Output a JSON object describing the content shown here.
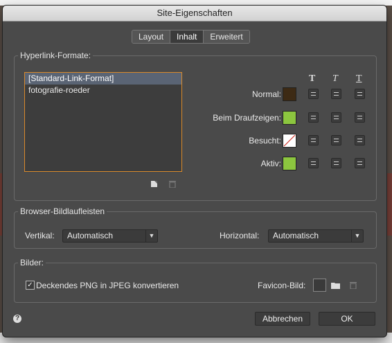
{
  "window": {
    "title": "Site-Eigenschaften"
  },
  "tabs": [
    {
      "label": "Layout",
      "active": false
    },
    {
      "label": "Inhalt",
      "active": true
    },
    {
      "label": "Erweitert",
      "active": false
    }
  ],
  "hyperlinks": {
    "group_title": "Hyperlink-Formate:",
    "list": [
      {
        "label": "[Standard-Link-Format]",
        "selected": true
      },
      {
        "label": "fotografie-roeder",
        "selected": false
      }
    ],
    "format_icons": [
      "bold-t-icon",
      "italic-t-icon",
      "underline-t-icon"
    ],
    "new_icon": "new-item-icon",
    "delete_icon": "trash-icon",
    "states": [
      {
        "label": "Normal:",
        "color": "#3d2a14"
      },
      {
        "label": "Beim Draufzeigen:",
        "color": "#8cc63f"
      },
      {
        "label": "Besucht:",
        "color": "none"
      },
      {
        "label": "Aktiv:",
        "color": "#8cc63f"
      }
    ]
  },
  "scrollbars": {
    "group_title": "Browser-Bildlaufleisten",
    "vertical_label": "Vertikal:",
    "vertical_value": "Automatisch",
    "horizontal_label": "Horizontal:",
    "horizontal_value": "Automatisch"
  },
  "images": {
    "group_title": "Bilder:",
    "png_checkbox_label": "Deckendes PNG in JPEG konvertieren",
    "png_checked": true,
    "favicon_label": "Favicon-Bild:"
  },
  "footer": {
    "cancel_label": "Abbrechen",
    "ok_label": "OK",
    "help_icon": "help-icon"
  }
}
